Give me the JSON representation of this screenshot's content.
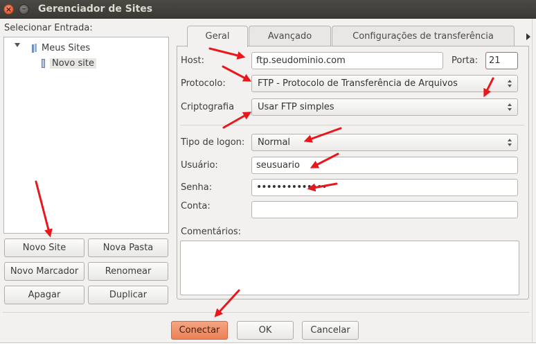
{
  "window": {
    "title": "Gerenciador de Sites",
    "close_glyph": "×",
    "minimize_glyph": "–"
  },
  "left": {
    "label": "Selecionar Entrada:",
    "tree": {
      "root": "Meus Sites",
      "child": "Novo site"
    },
    "buttons": {
      "new_site": "Novo Site",
      "new_folder": "Nova Pasta",
      "new_bookmark": "Novo Marcador",
      "rename": "Renomear",
      "delete": "Apagar",
      "duplicate": "Duplicar"
    }
  },
  "tabs": [
    "Geral",
    "Avançado",
    "Configurações de transferência"
  ],
  "general": {
    "host_label": "Host:",
    "host_value": "ftp.seudominio.com",
    "port_label": "Porta:",
    "port_value": "21",
    "protocol_label": "Protocolo:",
    "protocol_value": "FTP - Protocolo de Transferência de Arquivos",
    "encryption_label": "Criptografia",
    "encryption_value": "Usar FTP simples",
    "logon_label": "Tipo de logon:",
    "logon_value": "Normal",
    "user_label": "Usuário:",
    "user_value": "seusuario",
    "password_label": "Senha:",
    "password_value": "••••••••••••••",
    "account_label": "Conta:",
    "account_value": "",
    "comments_label": "Comentários:"
  },
  "footer": {
    "connect": "Conectar",
    "ok": "OK",
    "cancel": "Cancelar"
  },
  "colors": {
    "annotation_arrow": "#e8171b",
    "primary_button": "#ec8156",
    "focus_border": "#e05a29",
    "titlebar": "#3b3a36"
  }
}
